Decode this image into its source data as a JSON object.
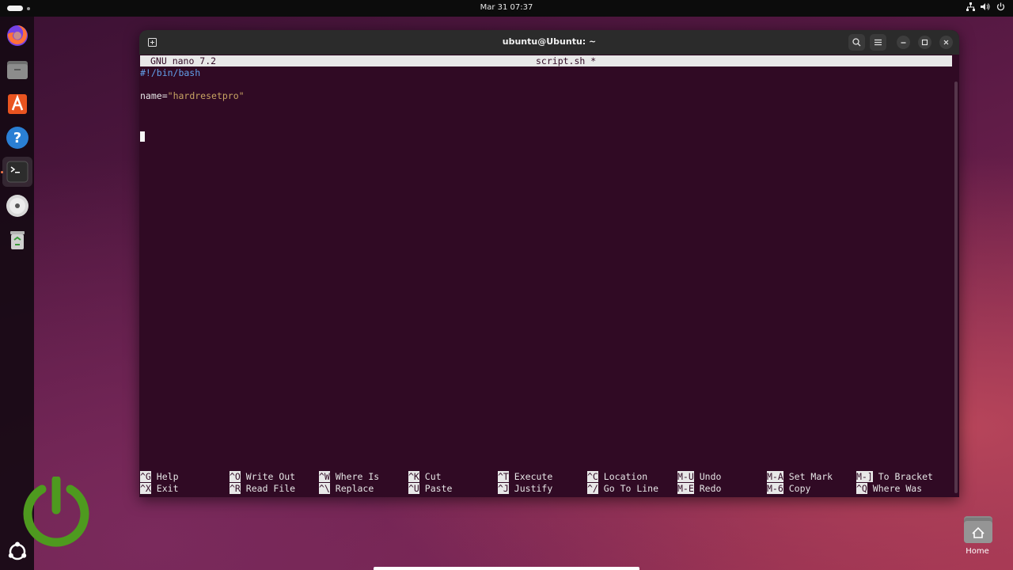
{
  "topbar": {
    "clock": "Mar 31  07:37",
    "tray_icons": [
      "network-icon",
      "volume-icon",
      "power-icon"
    ]
  },
  "dock": {
    "items": [
      {
        "name": "firefox",
        "icon": "firefox-icon",
        "running": false
      },
      {
        "name": "files",
        "icon": "files-icon",
        "running": false
      },
      {
        "name": "app-center",
        "icon": "app-center-icon",
        "running": false
      },
      {
        "name": "help",
        "icon": "help-icon",
        "running": false
      },
      {
        "name": "terminal",
        "icon": "terminal-icon",
        "running": true,
        "active": true
      },
      {
        "name": "disc",
        "icon": "disc-icon",
        "running": false
      },
      {
        "name": "trash",
        "icon": "trash-icon",
        "running": false
      }
    ],
    "show_apps_icon": "ubuntu-logo-icon"
  },
  "window": {
    "title": "ubuntu@Ubuntu: ~",
    "new_tab_icon": "new-tab-icon",
    "buttons": [
      "search-icon",
      "menu-icon",
      "minimize-icon",
      "maximize-icon",
      "close-icon"
    ]
  },
  "nano": {
    "version": "GNU nano 7.2",
    "filename": "script.sh *",
    "lines": {
      "shebang": "#!/bin/bash",
      "var_name": "name",
      "var_eq": "=",
      "var_value": "\"hardresetpro\""
    },
    "shortcuts": [
      {
        "key": "^G",
        "label": "Help"
      },
      {
        "key": "^O",
        "label": "Write Out"
      },
      {
        "key": "^W",
        "label": "Where Is"
      },
      {
        "key": "^K",
        "label": "Cut"
      },
      {
        "key": "^T",
        "label": "Execute"
      },
      {
        "key": "^C",
        "label": "Location"
      },
      {
        "key": "M-U",
        "label": "Undo"
      },
      {
        "key": "M-A",
        "label": "Set Mark"
      },
      {
        "key": "M-]",
        "label": "To Bracket"
      },
      {
        "key": "^X",
        "label": "Exit"
      },
      {
        "key": "^R",
        "label": "Read File"
      },
      {
        "key": "^\\",
        "label": "Replace"
      },
      {
        "key": "^U",
        "label": "Paste"
      },
      {
        "key": "^J",
        "label": "Justify"
      },
      {
        "key": "^/",
        "label": "Go To Line"
      },
      {
        "key": "M-E",
        "label": "Redo"
      },
      {
        "key": "M-6",
        "label": "Copy"
      },
      {
        "key": "^Q",
        "label": "Where Was"
      }
    ]
  },
  "desktop": {
    "home_label": "Home"
  },
  "colors": {
    "terminal_bg": "#300a24",
    "comment": "#62a0ea",
    "string": "#c8a463",
    "logo_green": "#4e9a1f"
  }
}
